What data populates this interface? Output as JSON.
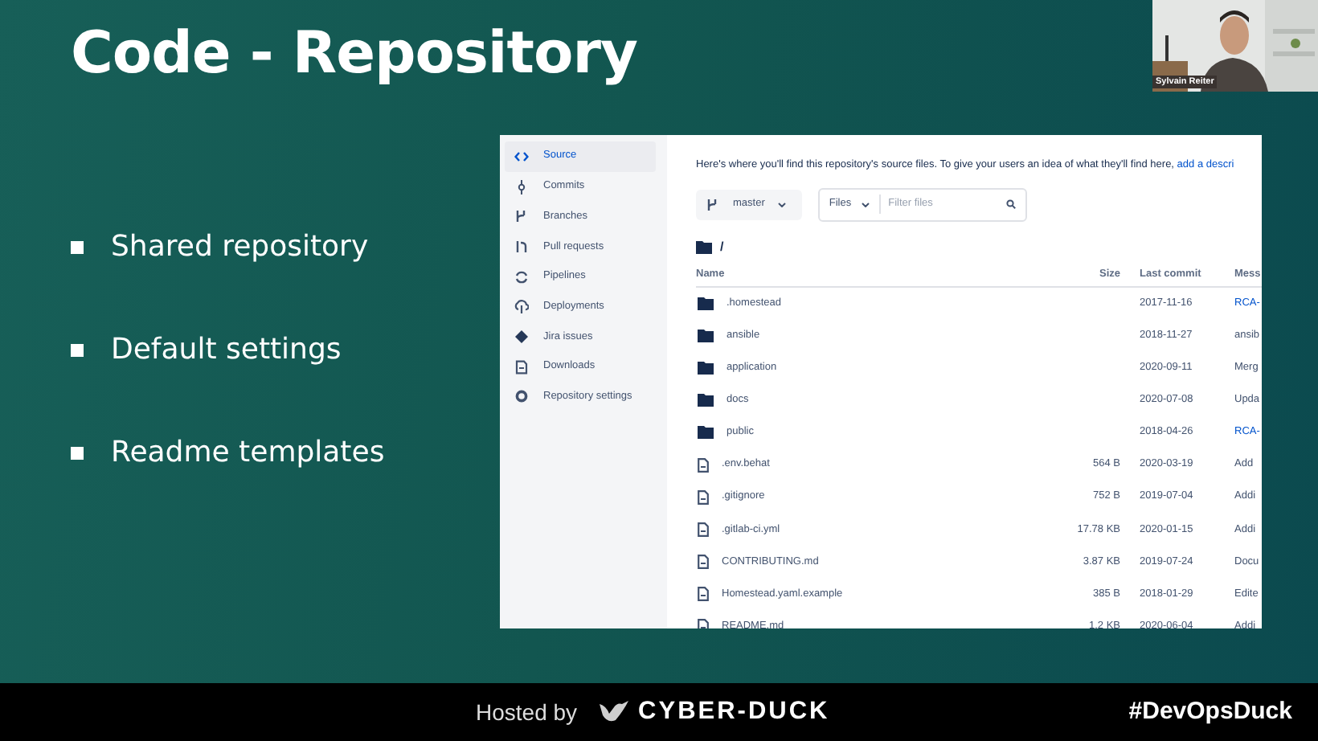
{
  "slide": {
    "title": "Code - Repository",
    "bullets": [
      "Shared repository",
      "Default settings",
      "Readme templates"
    ]
  },
  "webcam": {
    "kind": "picture",
    "caption": "Sylvain Reiter"
  },
  "repository": {
    "sidebar": {
      "items": [
        {
          "label": "Source",
          "selected": true
        },
        {
          "label": "Commits",
          "selected": false
        },
        {
          "label": "Branches",
          "selected": false
        },
        {
          "label": "Pull requests",
          "selected": false
        },
        {
          "label": "Pipelines",
          "selected": false
        },
        {
          "label": "Deployments",
          "selected": false
        },
        {
          "label": "Jira issues",
          "selected": false
        },
        {
          "label": "Downloads",
          "selected": false
        },
        {
          "label": "Repository settings",
          "selected": false
        }
      ]
    },
    "intro": {
      "text": "Here's where you'll find this repository's source files. To give your users an idea of what they'll find here,",
      "link": "add a descri"
    },
    "branch": "master",
    "files_dropdown": "Files",
    "filter": {
      "placeholder": "Filter files"
    },
    "path": "/",
    "table": {
      "columns": [
        "Name",
        "Size",
        "Last commit",
        "Mess"
      ],
      "rows": [
        {
          "kind": "folder",
          "name": ".homestead",
          "size": "",
          "last_commit": "2017-11-16",
          "column_4": "RCA-",
          "link": true
        },
        {
          "kind": "folder",
          "name": "ansible",
          "last_commit": "2018-11-27",
          "column_4": "ansib",
          "link": false
        },
        {
          "kind": "folder",
          "name": "application",
          "last_commit": "2020-09-11",
          "column_4": "Merg",
          "link": false
        },
        {
          "kind": "folder",
          "name": "docs",
          "last_commit": "2020-07-08",
          "column_4": "Upda",
          "link": false
        },
        {
          "kind": "folder",
          "name": "public",
          "last_commit": "2018-04-26",
          "column_4": "RCA-",
          "link": true
        },
        {
          "kind": "file",
          "name": ".env.behat",
          "size": "564 B",
          "last_commit": "2020-03-19",
          "column_4": "Add",
          "link": false
        },
        {
          "kind": "file",
          "name": ".gitignore",
          "size": "752 B",
          "last_commit": "2019-07-04",
          "column_4": "Addi",
          "link": false
        },
        {
          "kind": "file",
          "name": ".gitlab-ci.yml",
          "size": "17.78 KB",
          "last_commit": "2020-01-15",
          "column_4": "Addi",
          "link": false
        },
        {
          "kind": "file",
          "name": "CONTRIBUTING.md",
          "size": "3.87 KB",
          "last_commit": "2019-07-24",
          "column_4": "Docu",
          "link": false
        },
        {
          "kind": "file",
          "name": "Homestead.yaml.example",
          "size": "385 B",
          "last_commit": "2018-01-29",
          "column_4": "Edite",
          "link": false
        },
        {
          "kind": "file",
          "name": "README.md",
          "size": "1.2 KB",
          "last_commit": "2020-06-04",
          "column_4": "Addi",
          "link": false
        }
      ]
    }
  },
  "footer": {
    "hosted_by": "Hosted by",
    "brand": "CYBER-DUCK",
    "hashtag": "#DevOpsDuck"
  }
}
